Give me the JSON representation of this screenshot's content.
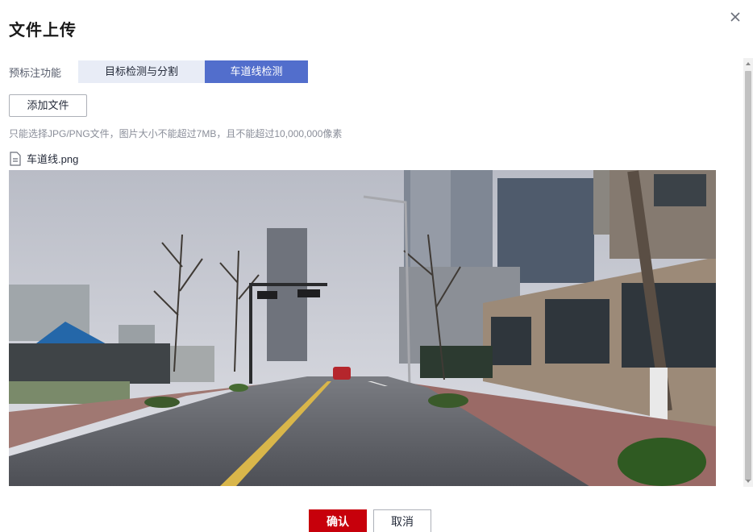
{
  "dialog": {
    "title": "文件上传",
    "close_icon": "close-icon"
  },
  "preset_function": {
    "label": "预标注功能",
    "tabs": [
      {
        "label": "目标检测与分割",
        "selected": false
      },
      {
        "label": "车道线检测",
        "selected": true
      }
    ]
  },
  "upload": {
    "add_button_label": "添加文件",
    "hint": "只能选择JPG/PNG文件，图片大小不能超过7MB，且不能超过10,000,000像素"
  },
  "file": {
    "icon": "file-icon",
    "name": "车道线.png"
  },
  "footer": {
    "confirm_label": "确认",
    "cancel_label": "取消"
  },
  "colors": {
    "accent": "#526ecc",
    "tab_inactive": "#e8ecf6",
    "primary_button": "#c7000b"
  }
}
